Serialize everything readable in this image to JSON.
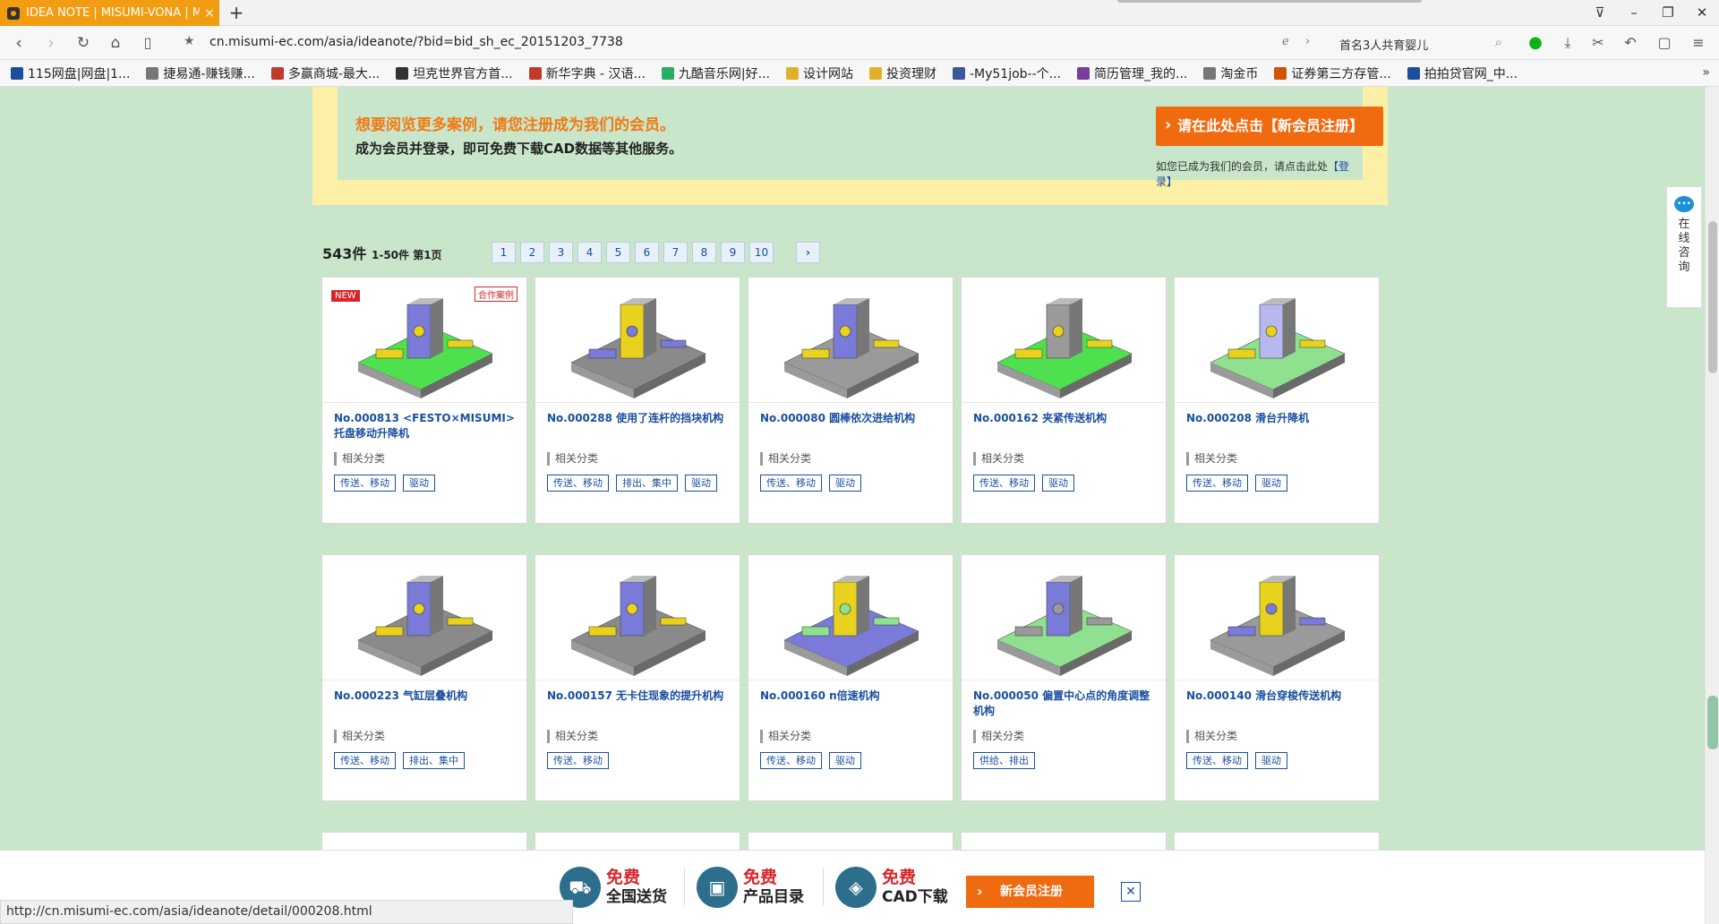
{
  "browser": {
    "tab_title": "IDEA NOTE | MISUMI-VONA | MI",
    "tab_close": "×",
    "new_tab": "+",
    "url": "cn.misumi-ec.com/asia/ideanote/?bid=bid_sh_ec_20151203_7738",
    "search_text": "首名3人共育婴儿",
    "bookmarks": [
      {
        "label": "115网盘|网盘|1...",
        "icon": "115-icon",
        "color": "#1b4f9c"
      },
      {
        "label": "捷易通-赚钱赚...",
        "icon": "globe-icon",
        "color": "#777777"
      },
      {
        "label": "多赢商城-最大...",
        "icon": "shop-icon",
        "color": "#c0392b"
      },
      {
        "label": "坦克世界官方首...",
        "icon": "tank-icon",
        "color": "#333333"
      },
      {
        "label": "新华字典 - 汉语...",
        "icon": "dictionary-icon",
        "color": "#c0392b"
      },
      {
        "label": "九酷音乐网|好...",
        "icon": "music-icon",
        "color": "#27ae60"
      },
      {
        "label": "设计网站",
        "icon": "folder-icon",
        "color": "#e1b12c"
      },
      {
        "label": "投资理财",
        "icon": "folder-icon",
        "color": "#e1b12c"
      },
      {
        "label": "-My51job--个...",
        "icon": "hand-icon",
        "color": "#3b5998"
      },
      {
        "label": "简历管理_我的...",
        "icon": "resume-icon",
        "color": "#7a3b9c"
      },
      {
        "label": "淘金币",
        "icon": "globe-icon",
        "color": "#777777"
      },
      {
        "label": "证券第三方存管...",
        "icon": "stock-icon",
        "color": "#d35400"
      },
      {
        "label": "拍拍贷官网_中...",
        "icon": "ppd-icon",
        "color": "#1b4f9c"
      }
    ]
  },
  "promo": {
    "line1": "想要阅览更多案例，请您注册成为我们的会员。",
    "line2": "成为会员并登录，即可免费下载CAD数据等其他服务。",
    "register_button": "请在此处点击【新会员注册】",
    "login_tip": "如您已成为我们的会员，请点击此处",
    "login_link": "【登录】"
  },
  "results": {
    "count": "543件",
    "range": "1-50件 第1页",
    "pages": [
      "1",
      "2",
      "3",
      "4",
      "5",
      "6",
      "7",
      "8",
      "9",
      "10"
    ],
    "next": "›"
  },
  "category_label": "相关分类",
  "badges": {
    "new": "NEW",
    "collab": "合作案例"
  },
  "cards": [
    {
      "title": "No.000813 <FESTO×MISUMI>托盘移动升降机",
      "tags": [
        "传送、移动",
        "驱动"
      ]
    },
    {
      "title": "No.000288 使用了连杆的挡块机构",
      "tags": [
        "传送、移动",
        "排出、集中",
        "驱动"
      ]
    },
    {
      "title": "No.000080 圆棒依次进给机构",
      "tags": [
        "传送、移动",
        "驱动"
      ]
    },
    {
      "title": "No.000162 夹紧传送机构",
      "tags": [
        "传送、移动",
        "驱动"
      ]
    },
    {
      "title": "No.000208 滑台升降机",
      "tags": [
        "传送、移动",
        "驱动"
      ]
    },
    {
      "title": "No.000223 气缸层叠机构",
      "tags": [
        "传送、移动",
        "排出、集中"
      ]
    },
    {
      "title": "No.000157 无卡住现象的提升机构",
      "tags": [
        "传送、移动"
      ]
    },
    {
      "title": "No.000160 n倍速机构",
      "tags": [
        "传送、移动",
        "驱动"
      ]
    },
    {
      "title": "No.000050 偏置中心点的角度调整机构",
      "tags": [
        "供给、排出"
      ]
    },
    {
      "title": "No.000140 滑台穿梭传送机构",
      "tags": [
        "传送、移动",
        "驱动"
      ]
    }
  ],
  "side": {
    "consult": "在线咨询"
  },
  "bottom_bar": {
    "items": [
      {
        "free": "免费",
        "what": "全国送货",
        "icon": "delivery-truck-icon"
      },
      {
        "free": "免费",
        "what": "产品目录",
        "icon": "catalog-book-icon"
      },
      {
        "free": "免费",
        "what": "CAD下载",
        "icon": "cad-cube-icon"
      }
    ],
    "register": "新会员注册",
    "close": "✕"
  },
  "status_url": "http://cn.misumi-ec.com/asia/ideanote/detail/000208.html",
  "colors": {
    "page_bg": "#c9e6cb",
    "accent_orange": "#f06a0f",
    "link_blue": "#1a4fa0",
    "promo_border": "#fcefa6",
    "badge_red": "#d7262b"
  }
}
